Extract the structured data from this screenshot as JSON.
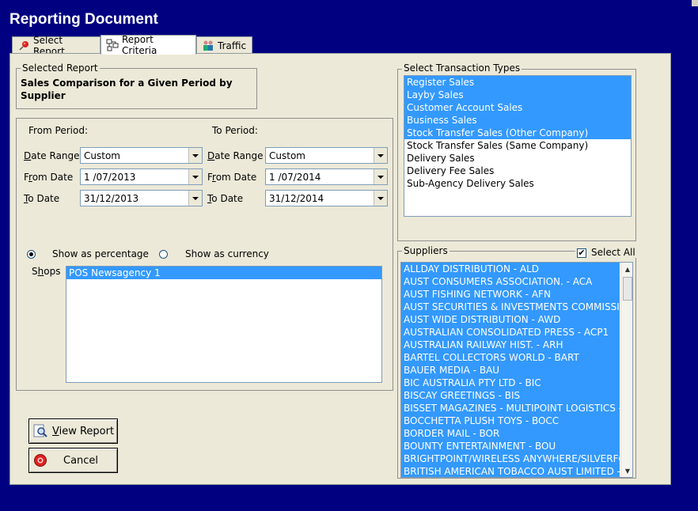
{
  "window": {
    "title": "Reporting Document"
  },
  "tabs": [
    {
      "label": "Select Report",
      "icon": "pushpin-icon"
    },
    {
      "label": "Report Criteria",
      "icon": "criteria-icon"
    },
    {
      "label": "Traffic",
      "icon": "people-icon"
    }
  ],
  "selected_report": {
    "legend": "Selected Report",
    "name": "Sales Comparison for a Given Period by Supplier"
  },
  "period": {
    "from_heading": "From Period:",
    "to_heading": "To Period:",
    "date_range_label": "Date Range",
    "from_date_label": "From Date",
    "to_date_label": "To Date",
    "from": {
      "date_range": "Custom",
      "from_date": "1 /07/2013",
      "to_date": "31/12/2013"
    },
    "to": {
      "date_range": "Custom",
      "from_date": "1 /07/2014",
      "to_date": "31/12/2014"
    }
  },
  "display": {
    "show_percentage": "Show as percentage",
    "show_currency": "Show as currency",
    "selected": "percentage"
  },
  "shops": {
    "label": "Shops",
    "items": [
      "POS Newsagency 1"
    ]
  },
  "buttons": {
    "view_report": "View Report",
    "cancel": "Cancel"
  },
  "transaction_types": {
    "legend": "Select Transaction Types",
    "items": [
      {
        "label": "Register Sales",
        "selected": true
      },
      {
        "label": "Layby Sales",
        "selected": true
      },
      {
        "label": "Customer Account Sales",
        "selected": true
      },
      {
        "label": "Business Sales",
        "selected": true
      },
      {
        "label": "Stock Transfer Sales (Other Company)",
        "selected": true
      },
      {
        "label": "Stock Transfer Sales (Same Company)",
        "selected": false
      },
      {
        "label": "Delivery Sales",
        "selected": false
      },
      {
        "label": "Delivery Fee Sales",
        "selected": false
      },
      {
        "label": "Sub-Agency Delivery Sales",
        "selected": false
      }
    ]
  },
  "suppliers": {
    "legend": "Suppliers",
    "select_all_label": "Select All",
    "select_all_checked": true,
    "items": [
      "ALLDAY DISTRIBUTION - ALD",
      "AUST CONSUMERS ASSOCIATION. - ACA",
      "AUST FISHING NETWORK - AFN",
      "AUST SECURITIES & INVESTMENTS COMMISSI",
      "AUST WIDE DISTRIBUTION - AWD",
      "AUSTRALIAN CONSOLIDATED PRESS - ACP1",
      "AUSTRALIAN RAILWAY HIST. - ARH",
      "BARTEL COLLECTORS WORLD - BART",
      "BAUER MEDIA - BAU",
      "BIC AUSTRALIA PTY LTD - BIC",
      "BISCAY GREETINGS - BIS",
      "BISSET MAGAZINES - MULTIPOINT LOGISTICS -",
      "BOCCHETTA PLUSH TOYS - BOCC",
      "BORDER MAIL - BOR",
      "BOUNTY ENTERTAINMENT - BOU",
      "BRIGHTPOINT/WIRELESS ANYWHERE/SILVERFO",
      "BRITISH AMERICAN TOBACCO AUST LIMITED -"
    ]
  }
}
